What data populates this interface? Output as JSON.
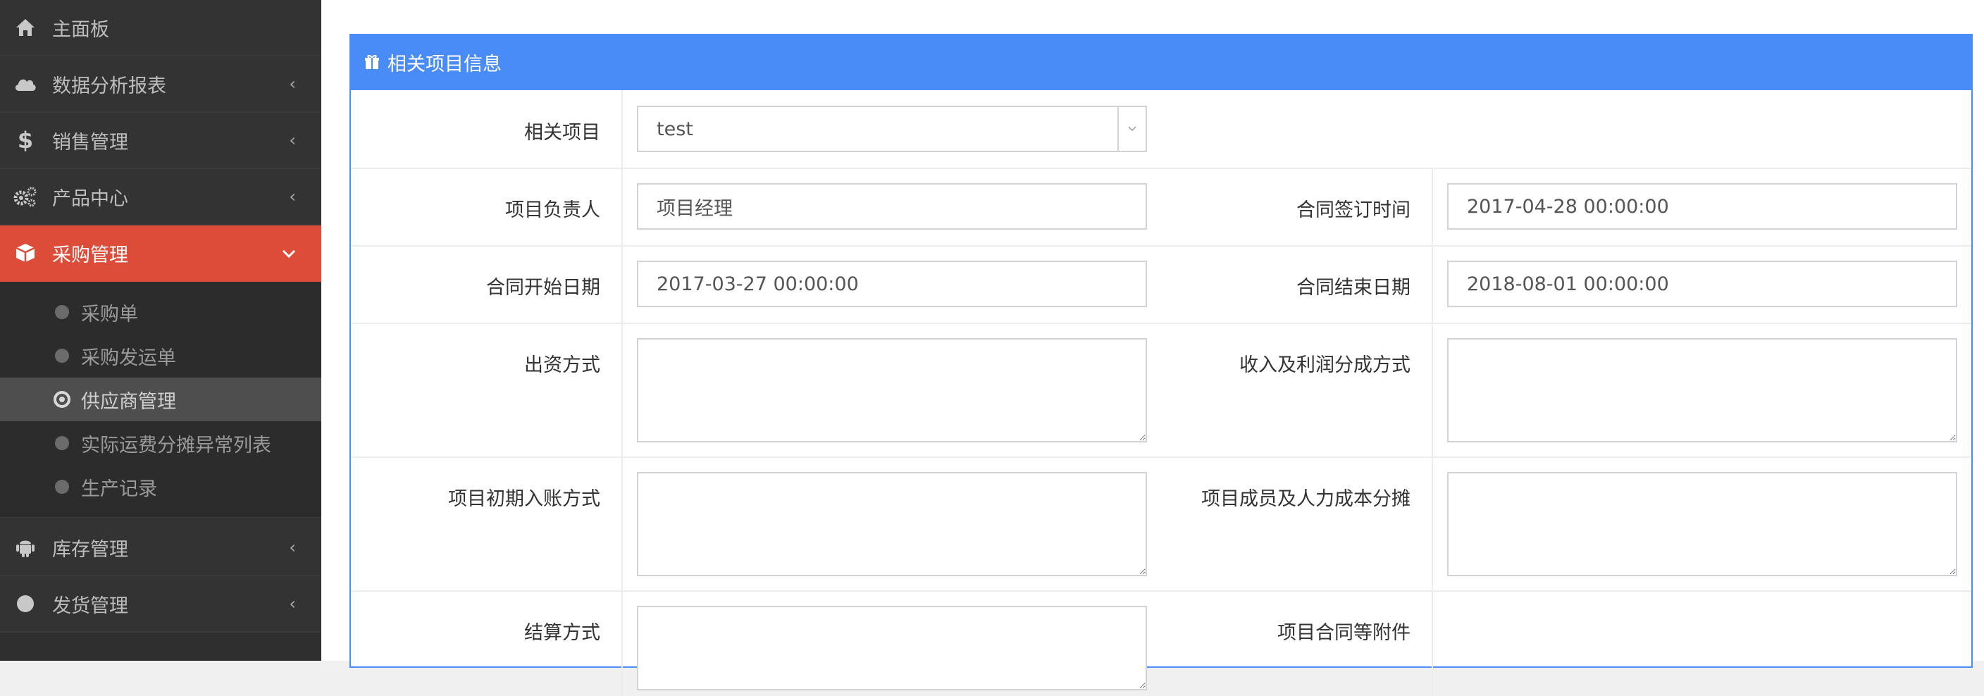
{
  "sidebar": {
    "items": [
      {
        "label": "主面板",
        "icon": "home-icon",
        "has_arrow": false
      },
      {
        "label": "数据分析报表",
        "icon": "cloud-icon",
        "has_arrow": true
      },
      {
        "label": "销售管理",
        "icon": "dollar-icon",
        "has_arrow": true
      },
      {
        "label": "产品中心",
        "icon": "gears-icon",
        "has_arrow": true
      },
      {
        "label": "采购管理",
        "icon": "cube-icon",
        "has_arrow": true,
        "active": true
      },
      {
        "label": "库存管理",
        "icon": "android-icon",
        "has_arrow": true
      },
      {
        "label": "发货管理",
        "icon": "circle-icon",
        "has_arrow": true
      }
    ],
    "submenu": [
      {
        "label": "采购单"
      },
      {
        "label": "采购发运单"
      },
      {
        "label": "供应商管理",
        "selected": true
      },
      {
        "label": "实际运费分摊异常列表"
      },
      {
        "label": "生产记录"
      }
    ],
    "arrow_collapsed": "‹",
    "arrow_expanded": "⌄"
  },
  "panel": {
    "title": "相关项目信息",
    "title_icon": "gift-icon",
    "header_color": "#4a8cf7",
    "fields": {
      "project_label": "相关项目",
      "project_value": "test",
      "manager_label": "项目负责人",
      "manager_value": "项目经理",
      "sign_time_label": "合同签订时间",
      "sign_time_value": "2017-04-28 00:00:00",
      "start_date_label": "合同开始日期",
      "start_date_value": "2017-03-27 00:00:00",
      "end_date_label": "合同结束日期",
      "end_date_value": "2018-08-01 00:00:00",
      "funding_label": "出资方式",
      "profit_label": "收入及利润分成方式",
      "initial_entry_label": "项目初期入账方式",
      "members_cost_label": "项目成员及人力成本分摊",
      "settlement_label": "结算方式",
      "attachment_label": "项目合同等附件"
    }
  },
  "colors": {
    "sidebar_bg": "#333333",
    "active_bg": "#dd4b39",
    "accent": "#4a8cf7"
  }
}
